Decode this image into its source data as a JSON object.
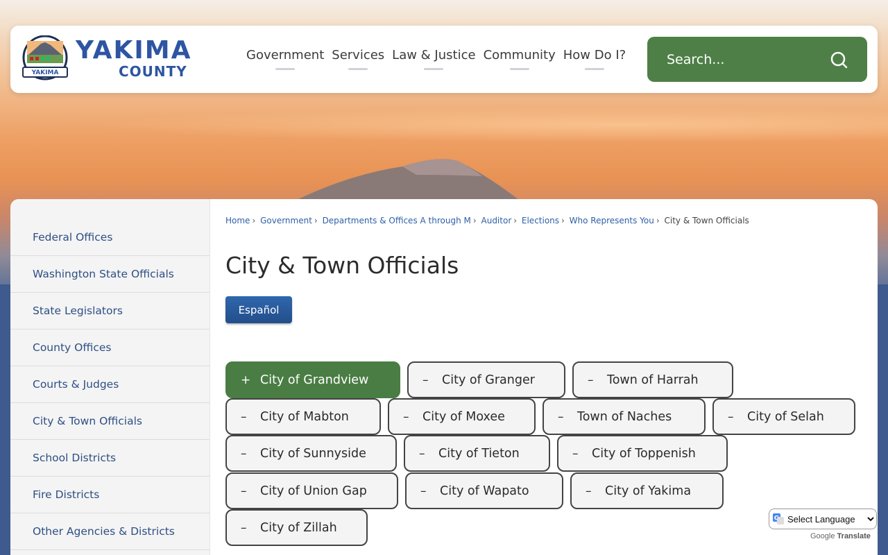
{
  "header": {
    "logo_title": "YAKIMA",
    "logo_subtitle": "COUNTY",
    "nav": [
      "Government",
      "Services",
      "Law & Justice",
      "Community",
      "How Do I?"
    ],
    "search_placeholder": "Search..."
  },
  "sidebar": {
    "items": [
      "Federal Offices",
      "Washington State Officials",
      "State Legislators",
      "County Offices",
      "Courts & Judges",
      "City & Town Officials",
      "School Districts",
      "Fire Districts",
      "Other Agencies & Districts"
    ]
  },
  "breadcrumb": {
    "items": [
      "Home",
      "Government",
      "Departments & Offices A through M",
      "Auditor",
      "Elections",
      "Who Represents You"
    ],
    "current": "City & Town Officials",
    "separator": "›"
  },
  "main": {
    "title": "City & Town Officials",
    "espanol_label": "Español"
  },
  "tabs": [
    {
      "label": "City of Grandview",
      "symbol": "+",
      "active": true
    },
    {
      "label": "City of Granger",
      "symbol": "–",
      "active": false
    },
    {
      "label": "Town of Harrah",
      "symbol": "–",
      "active": false
    },
    {
      "label": "City of Mabton",
      "symbol": "–",
      "active": false
    },
    {
      "label": "City of Moxee",
      "symbol": "–",
      "active": false
    },
    {
      "label": "Town of Naches",
      "symbol": "–",
      "active": false
    },
    {
      "label": "City of Selah",
      "symbol": "–",
      "active": false
    },
    {
      "label": "City of Sunnyside",
      "symbol": "–",
      "active": false
    },
    {
      "label": "City of Tieton",
      "symbol": "–",
      "active": false
    },
    {
      "label": "City of Toppenish",
      "symbol": "–",
      "active": false
    },
    {
      "label": "City of Union Gap",
      "symbol": "–",
      "active": false
    },
    {
      "label": "City of Wapato",
      "symbol": "–",
      "active": false
    },
    {
      "label": "City of Yakima",
      "symbol": "–",
      "active": false
    },
    {
      "label": "City of Zillah",
      "symbol": "–",
      "active": false
    }
  ],
  "translate": {
    "select_label": "Select Language",
    "powered_google": "Google",
    "powered_translate": "Translate"
  },
  "colors": {
    "brand_blue": "#2e55a3",
    "accent_green": "#4e7f47",
    "link_blue": "#2e4f84"
  }
}
